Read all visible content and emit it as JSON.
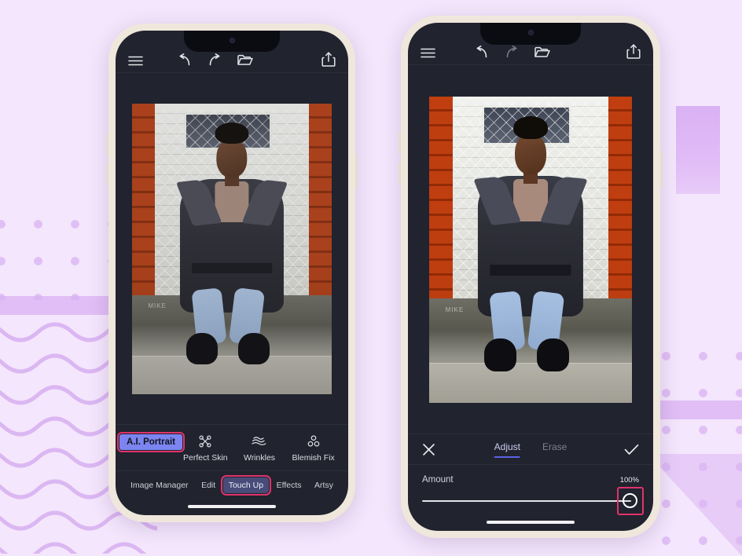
{
  "background": {
    "base_color": "#f4e6fc",
    "accent_color": "#d3a8ef",
    "patterns": [
      "polka-dots",
      "wavy-lines",
      "horizontal-band",
      "purple-block",
      "diagonal-triangle"
    ]
  },
  "highlight_color": "#e0336b",
  "phones": {
    "left": {
      "name": "Touch Up tool selection screen",
      "toolbar": {
        "menu_label": "menu-icon",
        "undo_label": "undo-icon",
        "redo_label": "redo-icon",
        "open_label": "open-folder-icon",
        "share_label": "share-icon"
      },
      "photo": {
        "watermark": "MIKE",
        "alt": "Woman in dark grey coat and light blue jeans seated against a chain-link fence between brick pillars"
      },
      "tools": [
        {
          "label": "A.I. Portrait",
          "icon": "ai-portrait",
          "selected": true,
          "highlighted": true
        },
        {
          "label": "Perfect Skin",
          "icon": "perfect-skin",
          "selected": false,
          "highlighted": false
        },
        {
          "label": "Wrinkles",
          "icon": "wrinkles",
          "selected": false,
          "highlighted": false
        },
        {
          "label": "Blemish Fix",
          "icon": "blemish-fix",
          "selected": false,
          "highlighted": false
        }
      ],
      "nav": [
        {
          "label": "Image Manager",
          "active": false,
          "highlighted": false
        },
        {
          "label": "Edit",
          "active": false,
          "highlighted": false
        },
        {
          "label": "Touch Up",
          "active": true,
          "highlighted": true
        },
        {
          "label": "Effects",
          "active": false,
          "highlighted": false
        },
        {
          "label": "Artsy",
          "active": false,
          "highlighted": false
        }
      ]
    },
    "right": {
      "name": "A.I. Portrait amount adjustment screen",
      "toolbar": {
        "menu_label": "menu-icon",
        "undo_label": "undo-icon",
        "redo_label": "redo-icon",
        "open_label": "open-folder-icon",
        "share_label": "share-icon"
      },
      "photo": {
        "watermark": "MIKE",
        "alt": "Enhanced portrait of woman seated against chain-link fence, brighter and more saturated"
      },
      "panel": {
        "cancel_label": "close-icon",
        "confirm_label": "check-icon",
        "tabs": [
          {
            "label": "Adjust",
            "active": true
          },
          {
            "label": "Erase",
            "active": false
          }
        ],
        "slider": {
          "label": "Amount",
          "value_label": "100%",
          "value": 100,
          "min": 0,
          "max": 100,
          "highlighted": true
        }
      }
    }
  }
}
